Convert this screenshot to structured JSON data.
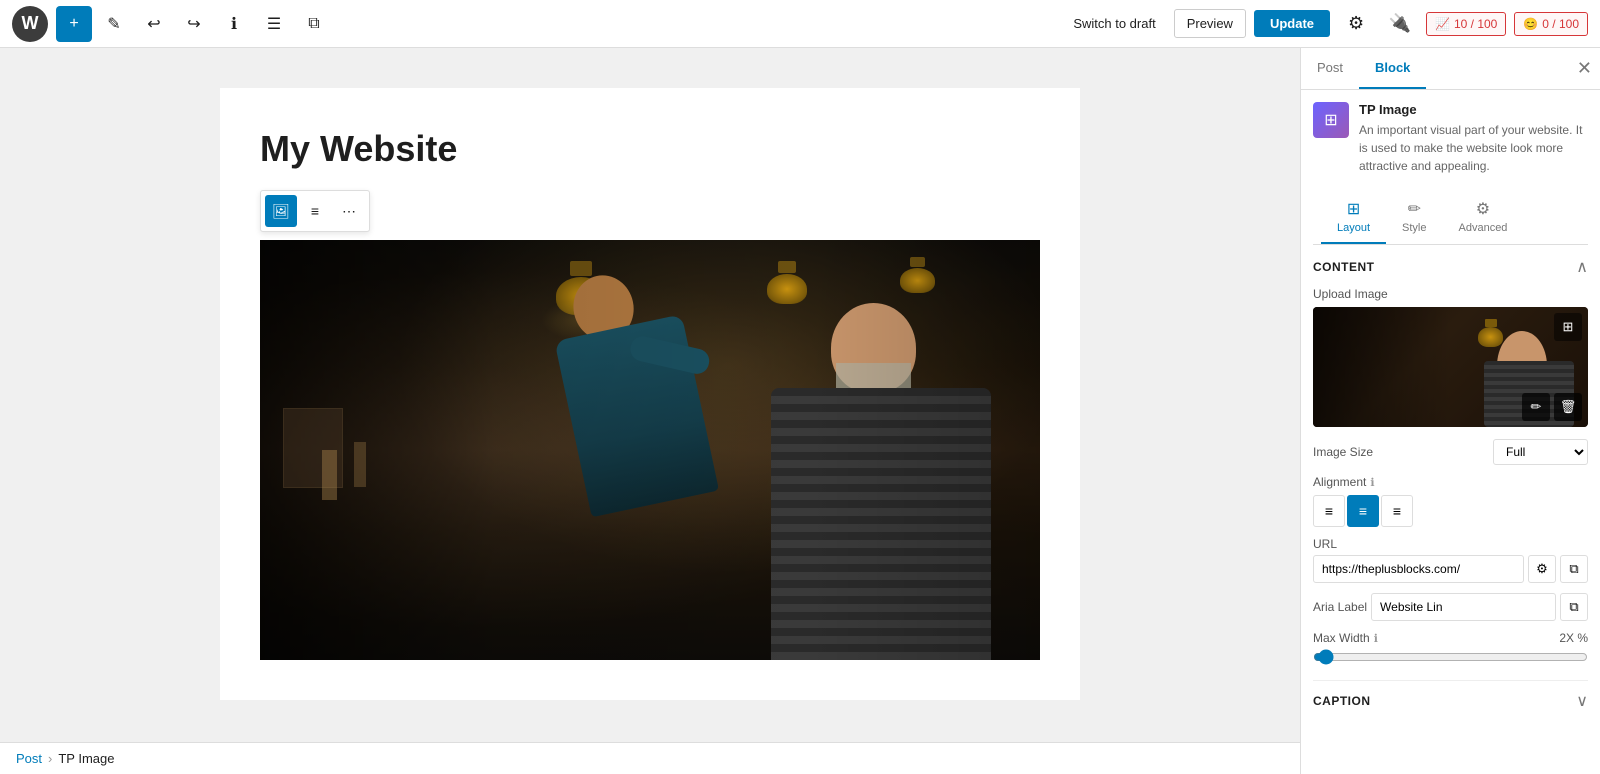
{
  "toolbar": {
    "logo": "W",
    "add_label": "+",
    "tools_label": "✎",
    "undo_label": "↩",
    "redo_label": "↪",
    "info_label": "ℹ",
    "list_label": "☰",
    "copy_label": "⧉",
    "switch_draft": "Switch to draft",
    "preview": "Preview",
    "update": "Update",
    "score_10": "10 / 100",
    "score_0": "0 / 100"
  },
  "page": {
    "title": "My Website"
  },
  "block_toolbar": {
    "image_btn": "🖼",
    "text_btn": "≡",
    "more_btn": "⋯"
  },
  "sidebar": {
    "tab_post": "Post",
    "tab_block": "Block",
    "active_tab": "block",
    "panel_layout": "Layout",
    "panel_style": "Style",
    "panel_advanced": "Advanced",
    "block_icon": "⊞",
    "block_name": "TP Image",
    "block_description": "An important visual part of your website. It is used to make the website look more attractive and appealing.",
    "content_section": "Content",
    "upload_image_label": "Upload Image",
    "image_size_label": "Image Size",
    "image_size_value": "Full",
    "alignment_label": "Alignment",
    "url_label": "URL",
    "url_value": "https://theplusblocks.com/",
    "aria_label": "Aria Label",
    "aria_value": "Website Lin",
    "max_width_label": "Max Width",
    "max_width_value": "2X %",
    "caption_label": "Caption"
  },
  "breadcrumb": {
    "post": "Post",
    "separator": "›",
    "current": "TP Image"
  }
}
